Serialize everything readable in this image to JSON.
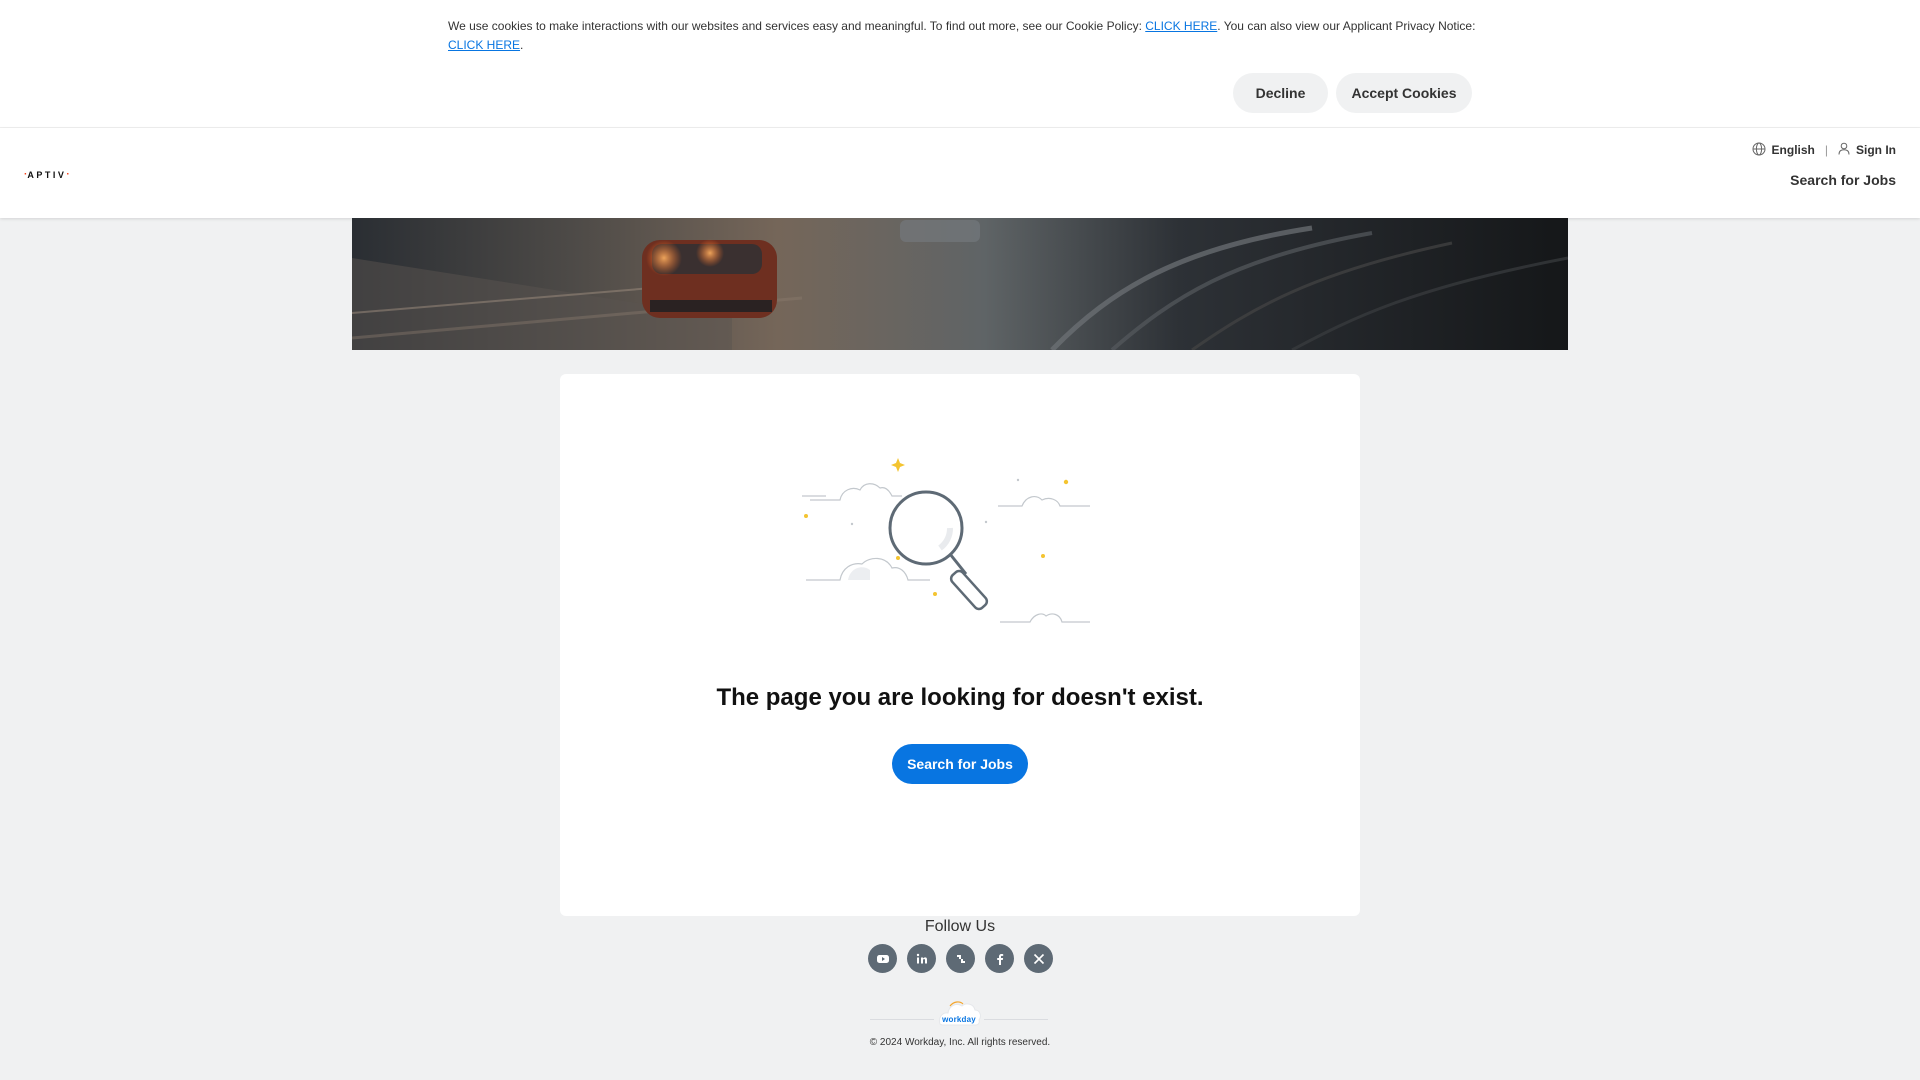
{
  "cookie_banner": {
    "text_part1": "We use cookies to make interactions with our websites and services easy and meaningful. To find out more, see our Cookie Policy: ",
    "link1_label": "CLICK HERE",
    "text_part2": ". You can also view our Applicant Privacy Notice: ",
    "link2_label": "CLICK HERE",
    "text_part3": ".",
    "decline_label": "Decline",
    "accept_label": "Accept Cookies"
  },
  "header": {
    "logo_text": "APTIV",
    "logo_accent_color": "#f84018",
    "language_label": "English",
    "signin_label": "Sign In",
    "search_link_label": "Search for Jobs",
    "icons": {
      "language": "globe-icon",
      "signin": "user-icon"
    }
  },
  "main": {
    "heading": "The page you are looking for doesn't exist.",
    "button_label": "Search for Jobs",
    "primary_color": "#0875e1",
    "illustration": "magnifying-glass-with-clouds"
  },
  "footer": {
    "follow_label": "Follow Us",
    "social": [
      {
        "name": "youtube-icon"
      },
      {
        "name": "linkedin-icon"
      },
      {
        "name": "glassdoor-icon"
      },
      {
        "name": "facebook-icon"
      },
      {
        "name": "x-icon"
      }
    ],
    "brand_text": "workday",
    "copyright": "© 2024 Workday, Inc. All rights reserved."
  }
}
